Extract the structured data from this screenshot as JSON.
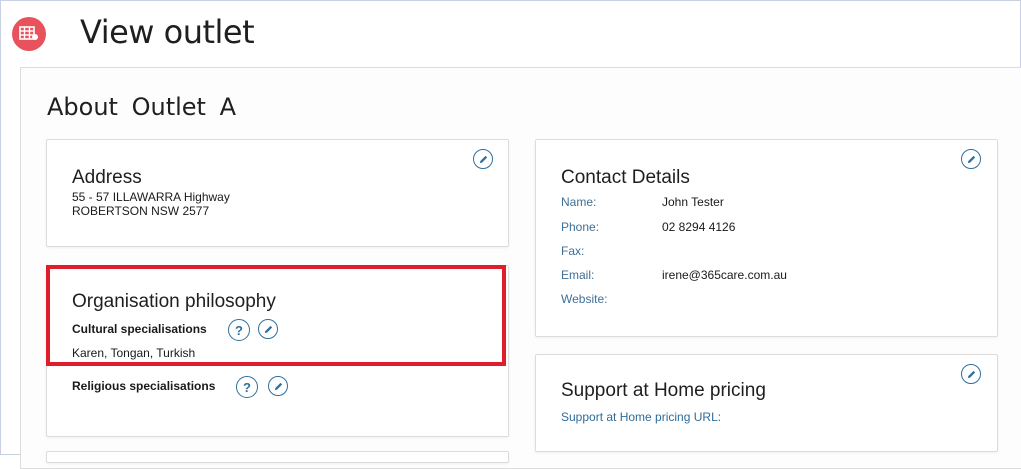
{
  "page": {
    "title": "View outlet"
  },
  "about": {
    "label": "About",
    "outlet_name": "Outlet A"
  },
  "address": {
    "title": "Address",
    "line1": "55 - 57 ILLAWARRA Highway",
    "line2": "ROBERTSON NSW 2577"
  },
  "philosophy": {
    "title": "Organisation philosophy",
    "cultural_label": "Cultural specialisations",
    "cultural_value": "Karen, Tongan, Turkish",
    "religious_label": "Religious specialisations",
    "help_glyph": "?"
  },
  "contact": {
    "title": "Contact Details",
    "name_label": "Name:",
    "name_value": "John Tester",
    "phone_label": "Phone:",
    "phone_value": "02 8294 4126",
    "fax_label": "Fax:",
    "fax_value": "",
    "email_label": "Email:",
    "email_value": "irene@365care.com.au",
    "website_label": "Website:",
    "website_value": ""
  },
  "pricing": {
    "title": "Support at Home pricing",
    "url_label": "Support at Home pricing URL:"
  },
  "colors": {
    "accent": "#2f6f9e",
    "brand": "#e8525d",
    "highlight": "#e01e2b"
  },
  "icons": {
    "title": "grid-calendar-icon",
    "edit": "pencil-icon",
    "help": "question-icon"
  }
}
